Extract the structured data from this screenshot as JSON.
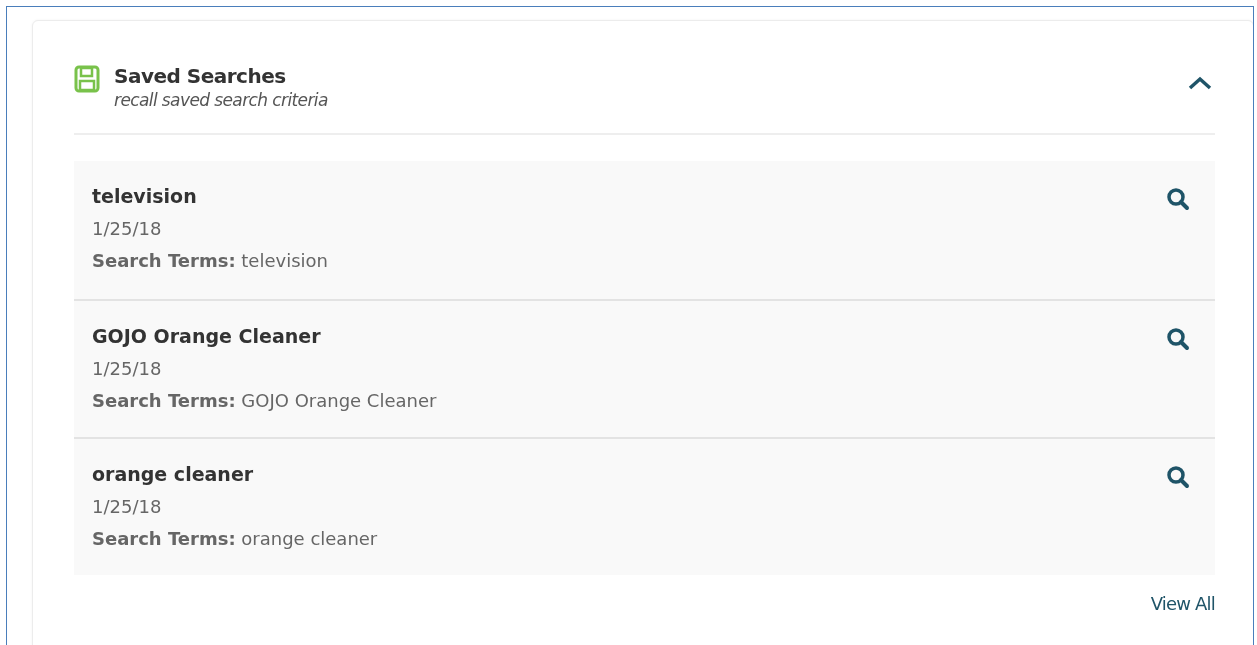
{
  "panel": {
    "title": "Saved Searches",
    "subtitle": "recall saved search criteria",
    "expanded": true
  },
  "searches": [
    {
      "name": "television",
      "date": "1/25/18",
      "terms": "**Search Terms:** television"
    },
    {
      "name": "GOJO Orange Cleaner",
      "date": "1/25/18",
      "terms": "**Search Terms:** GOJO Orange Cleaner"
    },
    {
      "name": "orange cleaner",
      "date": "1/25/18",
      "terms": "**Search Terms:** orange cleaner"
    }
  ],
  "view_all": "View All"
}
